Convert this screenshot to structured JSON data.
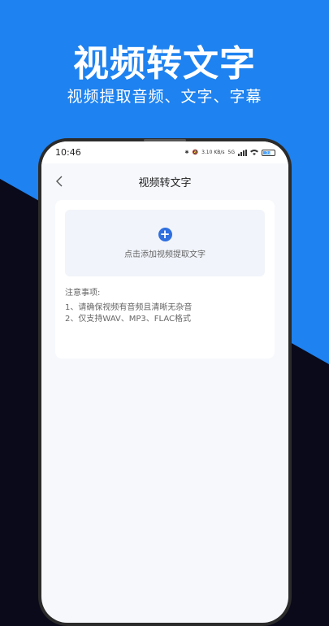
{
  "promo": {
    "title": "视频转文字",
    "subtitle": "视频提取音频、文字、字幕"
  },
  "status_bar": {
    "time": "10:46",
    "speed": "3.10 KB/s",
    "network": "5G",
    "battery": "51"
  },
  "nav": {
    "title": "视频转文字"
  },
  "upload": {
    "label": "点击添加视频提取文字"
  },
  "notes": {
    "title": "注意事项:",
    "items": [
      "1、请确保视频有音频且清晰无杂音",
      "2、仅支持WAV、MP3、FLAC格式"
    ]
  },
  "colors": {
    "brand_blue": "#1E82F0",
    "add_button": "#2F6FE0"
  }
}
